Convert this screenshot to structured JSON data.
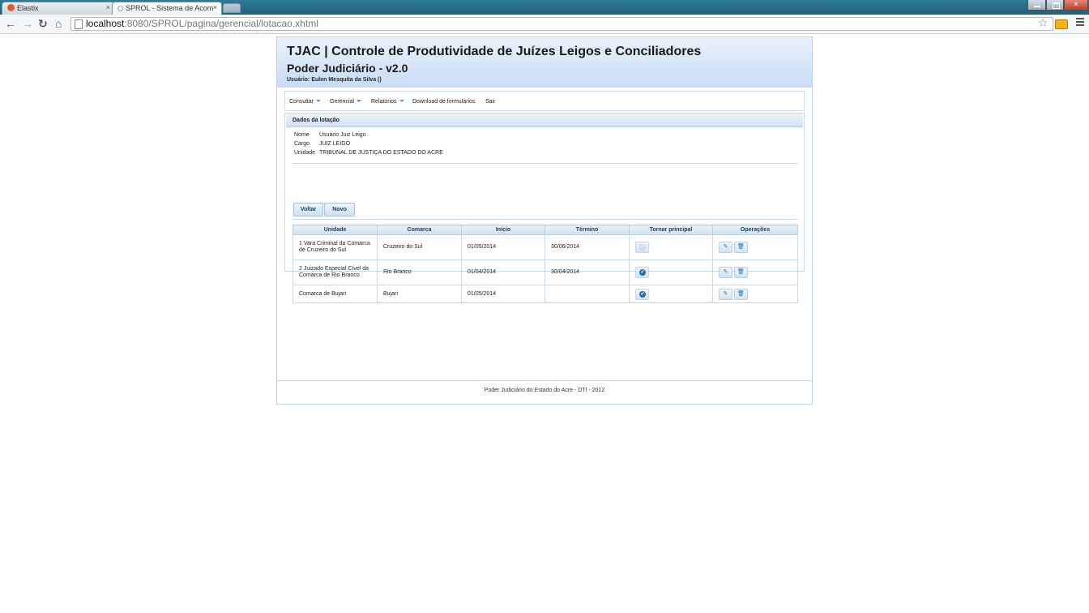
{
  "browser": {
    "tabs": [
      {
        "label": "Elastix",
        "active": false
      },
      {
        "label": "SPROL - Sistema de Acom",
        "active": true
      }
    ],
    "url_host": "localhost",
    "url_rest": ":8080/SPROL/pagina/gerencial/lotacao.xhtml",
    "close_glyph": "×"
  },
  "header": {
    "title": "TJAC | Controle de Produtividade de Juízes Leigos e Conciliadores",
    "subtitle": "Poder Judiciário - v2.0",
    "user": "Usuário: Eulen Mesquita da Silva ()"
  },
  "menu": {
    "items": [
      {
        "label": "Consultar",
        "dropdown": true
      },
      {
        "label": "Gerencial",
        "dropdown": true
      },
      {
        "label": "Relatórios",
        "dropdown": true
      },
      {
        "label": "Download de formulários",
        "dropdown": false
      },
      {
        "label": "Sair",
        "dropdown": false
      }
    ]
  },
  "panel": {
    "title": "Dados da lotação",
    "nome_label": "Nome",
    "nome_value": "Usuário Juiz Leigo",
    "cargo_label": "Cargo",
    "cargo_value": "JUIZ LEIGO",
    "unidade_label": "Unidade",
    "unidade_value": "TRIBUNAL DE JUSTIÇA DO ESTADO DO ACRE",
    "btn_voltar": "Voltar",
    "btn_novo": "Novo"
  },
  "table": {
    "columns": [
      "Unidade",
      "Comarca",
      "Início",
      "Término",
      "Tornar principal",
      "Operações"
    ],
    "rows": [
      {
        "unidade": "1 Vara Criminal da Comarca de Cruzeiro do Sul",
        "comarca": "Cruzeiro do Sul",
        "inicio": "01/05/2014",
        "termino": "30/06/2014",
        "principal": true
      },
      {
        "unidade": "2 Juizado Especial Cível da Comarca de Rio Branco",
        "comarca": "Rio Branco",
        "inicio": "01/04/2014",
        "termino": "30/04/2014",
        "principal": false
      },
      {
        "unidade": "Comarca de Bujari",
        "comarca": "Bujari",
        "inicio": "01/05/2014",
        "termino": "",
        "principal": false
      }
    ]
  },
  "footer": {
    "text": "Poder Judiciário do Estado do Acre - DTI - 2012"
  },
  "icons": {
    "check": "✔",
    "edit": "✎",
    "delete": "🗑"
  }
}
